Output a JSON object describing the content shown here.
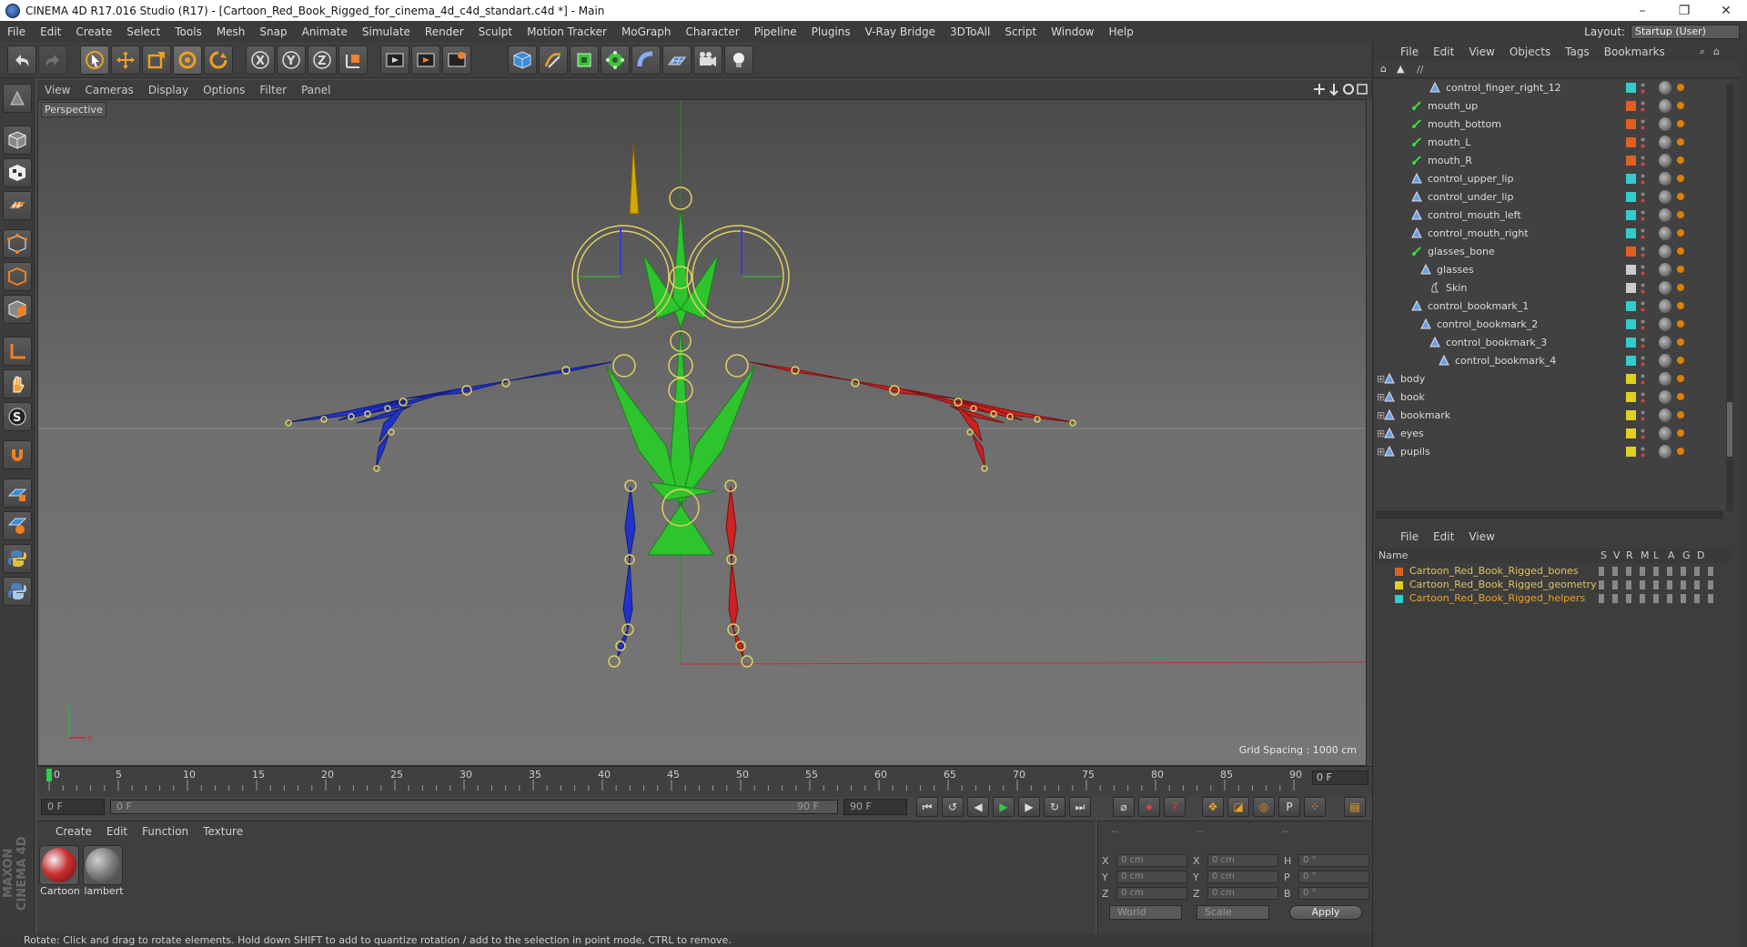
{
  "window": {
    "title": "CINEMA 4D R17.016 Studio (R17) - [Cartoon_Red_Book_Rigged_for_cinema_4d_c4d_standart.c4d *] - Main"
  },
  "menu": [
    "File",
    "Edit",
    "Create",
    "Select",
    "Tools",
    "Mesh",
    "Snap",
    "Animate",
    "Simulate",
    "Render",
    "Sculpt",
    "Motion Tracker",
    "MoGraph",
    "Character",
    "Pipeline",
    "Plugins",
    "V-Ray Bridge",
    "3DToAll",
    "Script",
    "Window",
    "Help"
  ],
  "layout": {
    "label": "Layout:",
    "value": "Startup (User)"
  },
  "viewport": {
    "menu": [
      "View",
      "Cameras",
      "Display",
      "Options",
      "Filter",
      "Panel"
    ],
    "label": "Perspective",
    "grid_spacing": "Grid Spacing : 1000 cm"
  },
  "timeline": {
    "ticks": [
      "0",
      "5",
      "10",
      "15",
      "20",
      "25",
      "30",
      "35",
      "40",
      "45",
      "50",
      "55",
      "60",
      "65",
      "70",
      "75",
      "80",
      "85",
      "90"
    ],
    "current_frame": "0 F",
    "start_field": "0 F",
    "range_start": "0 F",
    "range_end": "90 F",
    "end_field": "90 F"
  },
  "materials": {
    "menu": [
      "Create",
      "Edit",
      "Function",
      "Texture"
    ],
    "items": [
      {
        "name": "Cartoon"
      },
      {
        "name": "lambert"
      }
    ]
  },
  "attributes": {
    "header": [
      "--",
      "--",
      "--"
    ],
    "rows": [
      {
        "l1": "X",
        "v1": "0 cm",
        "l2": "X",
        "v2": "0 cm",
        "l3": "H",
        "v3": "0 °"
      },
      {
        "l1": "Y",
        "v1": "0 cm",
        "l2": "Y",
        "v2": "0 cm",
        "l3": "P",
        "v3": "0 °"
      },
      {
        "l1": "Z",
        "v1": "0 cm",
        "l2": "Z",
        "v2": "0 cm",
        "l3": "B",
        "v3": "0 °"
      }
    ],
    "coord_mode": "World",
    "scale_mode": "Scale",
    "apply": "Apply"
  },
  "status": "Rotate: Click and drag to rotate elements. Hold down SHIFT to add to quantize rotation / add to the selection in point mode, CTRL to remove.",
  "objects": {
    "menu": [
      "File",
      "Edit",
      "View",
      "Objects",
      "Tags",
      "Bookmarks"
    ],
    "path": "//",
    "rows": [
      {
        "name": "control_finger_right_12",
        "indent": 5,
        "color": "#33cccc",
        "type": "bone"
      },
      {
        "name": "mouth_up",
        "indent": 3,
        "color": "#e06020",
        "type": "joint"
      },
      {
        "name": "mouth_bottom",
        "indent": 3,
        "color": "#e06020",
        "type": "joint"
      },
      {
        "name": "mouth_L",
        "indent": 3,
        "color": "#e06020",
        "type": "joint"
      },
      {
        "name": "mouth_R",
        "indent": 3,
        "color": "#e06020",
        "type": "joint"
      },
      {
        "name": "control_upper_lip",
        "indent": 3,
        "color": "#33cccc",
        "type": "bone"
      },
      {
        "name": "control_under_lip",
        "indent": 3,
        "color": "#33cccc",
        "type": "bone"
      },
      {
        "name": "control_mouth_left",
        "indent": 3,
        "color": "#33cccc",
        "type": "bone"
      },
      {
        "name": "control_mouth_right",
        "indent": 3,
        "color": "#33cccc",
        "type": "bone"
      },
      {
        "name": "glasses_bone",
        "indent": 3,
        "color": "#e06020",
        "type": "joint"
      },
      {
        "name": "glasses",
        "indent": 4,
        "color": "#cccccc",
        "type": "bone"
      },
      {
        "name": "Skin",
        "indent": 5,
        "color": "#cccccc",
        "type": "skin"
      },
      {
        "name": "control_bookmark_1",
        "indent": 3,
        "color": "#33cccc",
        "type": "bone"
      },
      {
        "name": "control_bookmark_2",
        "indent": 4,
        "color": "#33cccc",
        "type": "bone"
      },
      {
        "name": "control_bookmark_3",
        "indent": 5,
        "color": "#33cccc",
        "type": "bone"
      },
      {
        "name": "control_bookmark_4",
        "indent": 6,
        "color": "#33cccc",
        "type": "bone"
      },
      {
        "name": "body",
        "indent": 0,
        "color": "#e0d020",
        "type": "bone"
      },
      {
        "name": "book",
        "indent": 0,
        "color": "#e0d020",
        "type": "bone"
      },
      {
        "name": "bookmark",
        "indent": 0,
        "color": "#e0d020",
        "type": "bone"
      },
      {
        "name": "eyes",
        "indent": 0,
        "color": "#e0d020",
        "type": "bone"
      },
      {
        "name": "pupils",
        "indent": 0,
        "color": "#e0d020",
        "type": "bone"
      }
    ]
  },
  "layers": {
    "menu": [
      "File",
      "Edit",
      "View"
    ],
    "header": {
      "name": "Name",
      "flags": [
        "S",
        "V",
        "R",
        "M",
        "L",
        "A",
        "G",
        "D"
      ]
    },
    "rows": [
      {
        "name": "Cartoon_Red_Book_Rigged_bones",
        "color": "#e06020",
        "highlight": false
      },
      {
        "name": "Cartoon_Red_Book_Rigged_geometry",
        "color": "#e0d020",
        "highlight": false
      },
      {
        "name": "Cartoon_Red_Book_Rigged_helpers",
        "color": "#33cccc",
        "highlight": true
      }
    ]
  },
  "colors": {
    "left_limb": "#2233cc",
    "right_limb": "#cc2222",
    "spine": "#22bb22",
    "joint": "#e0d060",
    "x_axis": "#cc3333",
    "y_axis": "#33aa33"
  }
}
